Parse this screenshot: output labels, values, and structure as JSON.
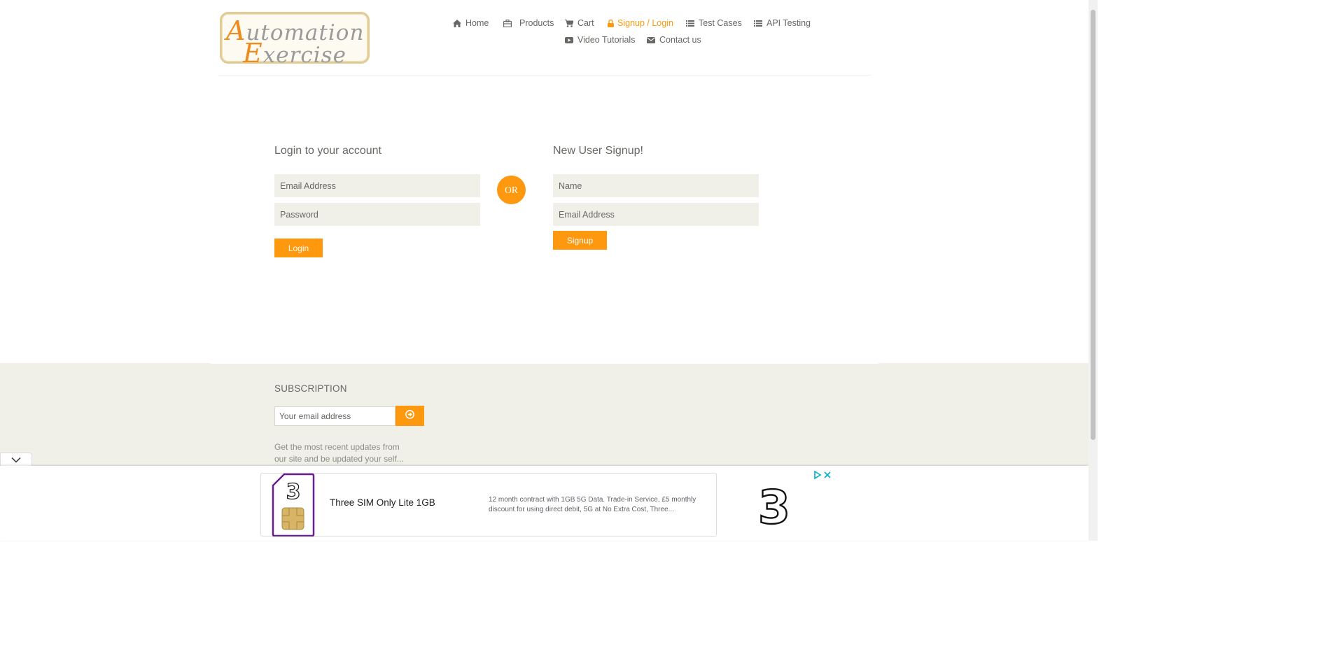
{
  "logo": {
    "line1_cap": "A",
    "line1_rest": "utomation",
    "line2_cap": "E",
    "line2_rest": "xercise"
  },
  "nav": {
    "home": {
      "label": "Home",
      "icon": "home-icon"
    },
    "products": {
      "label": "Products",
      "icon": "briefcase-icon"
    },
    "cart": {
      "label": "Cart",
      "icon": "cart-icon"
    },
    "signup_login": {
      "label": "Signup / Login",
      "icon": "lock-icon",
      "active": true
    },
    "test_cases": {
      "label": "Test Cases",
      "icon": "list-icon"
    },
    "api_testing": {
      "label": "API Testing",
      "icon": "list-icon"
    },
    "video_tutorials": {
      "label": "Video Tutorials",
      "icon": "youtube-icon"
    },
    "contact_us": {
      "label": "Contact us",
      "icon": "envelope-icon"
    }
  },
  "login": {
    "title": "Login to your account",
    "email_placeholder": "Email Address",
    "password_placeholder": "Password",
    "button": "Login"
  },
  "or_label": "OR",
  "signup": {
    "title": "New User Signup!",
    "name_placeholder": "Name",
    "email_placeholder": "Email Address",
    "button": "Signup"
  },
  "footer": {
    "subscription_title": "SUBSCRIPTION",
    "email_placeholder": "Your email address",
    "description": "Get the most recent updates from our site and be updated your self..."
  },
  "ad": {
    "title": "Three SIM Only Lite 1GB",
    "description": "12 month contract with 1GB 5G Data. Trade-in Service, £5 monthly discount for using direct debit, 5G at No Extra Cost, Three...",
    "brand_color": "#6b1f8f"
  },
  "colors": {
    "accent": "#fe980f",
    "text": "#696763",
    "field_bg": "#f0f0e9"
  }
}
